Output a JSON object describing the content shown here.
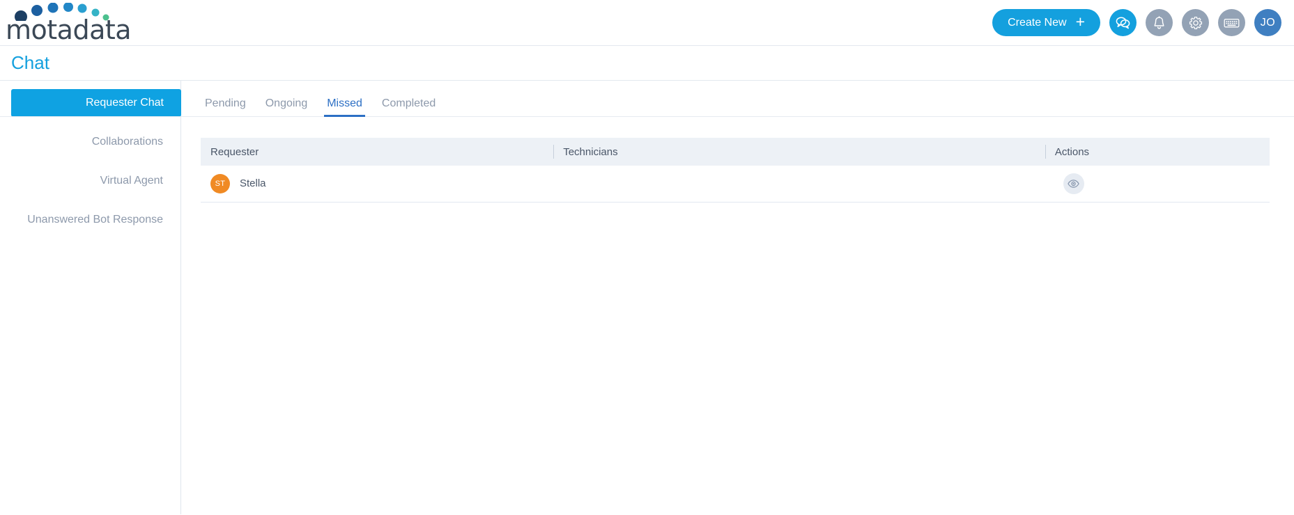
{
  "header": {
    "logo_text": "motadata",
    "create_new_label": "Create New",
    "plus_glyph": "+",
    "icons": [
      {
        "name": "chat-icon",
        "active": true
      },
      {
        "name": "bell-icon",
        "active": false
      },
      {
        "name": "gear-icon",
        "active": false
      },
      {
        "name": "keyboard-icon",
        "active": false
      }
    ],
    "avatar_initials": "JO",
    "accent_color": "#14a0de",
    "avatar_color": "#3f7fc1"
  },
  "page": {
    "title": "Chat",
    "title_color": "#14a0de"
  },
  "sidebar": {
    "items": [
      {
        "label": "Requester Chat",
        "active": true
      },
      {
        "label": "Collaborations",
        "active": false
      },
      {
        "label": "Virtual Agent",
        "active": false
      },
      {
        "label": "Unanswered Bot Response",
        "active": false
      }
    ]
  },
  "main": {
    "tabs": [
      {
        "label": "Pending",
        "active": false
      },
      {
        "label": "Ongoing",
        "active": false
      },
      {
        "label": "Missed",
        "active": true
      },
      {
        "label": "Completed",
        "active": false
      }
    ],
    "active_tab_color": "#2c6fc4",
    "table": {
      "columns": [
        {
          "label": "Requester"
        },
        {
          "label": "Technicians"
        },
        {
          "label": "Actions"
        }
      ],
      "rows": [
        {
          "requester_initials": "ST",
          "requester_initials_color": "#f08a24",
          "requester_name": "Stella",
          "technicians": "",
          "action_icon": "eye-icon"
        }
      ]
    }
  }
}
